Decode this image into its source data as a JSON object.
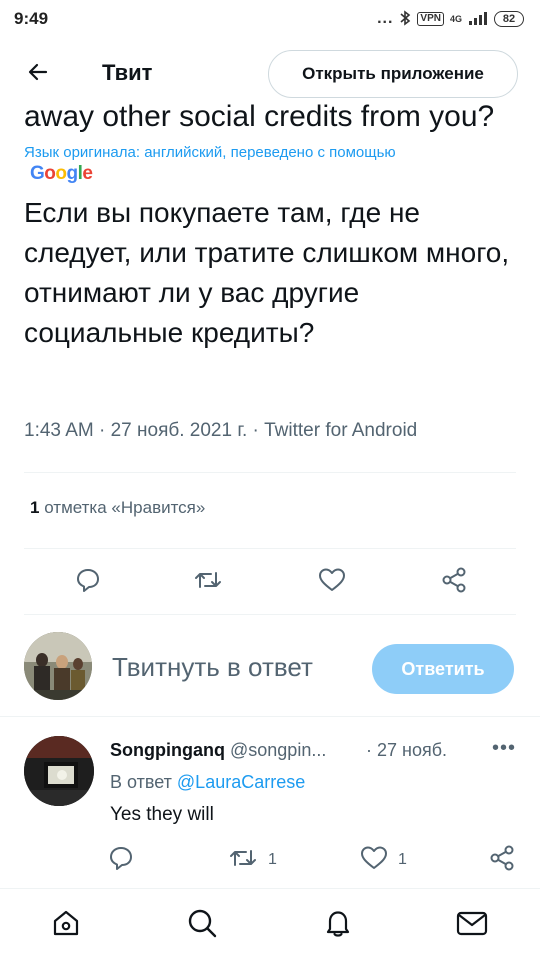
{
  "status_bar": {
    "time": "9:49",
    "dots": "...",
    "vpn": "VPN",
    "network": "4G",
    "battery": "82"
  },
  "header": {
    "title": "Твит",
    "open_app_label": "Открыть приложение"
  },
  "tweet": {
    "original_text": "away other social credits from you?",
    "translation_note": "Язык оригинала: английский, переведено с помощью",
    "translator": "Google",
    "translated_text": "Если вы покупаете там, где не следует, или тратите слишком много, отнимают ли у вас другие социальные кредиты?",
    "meta": "1:43 AM · 27 нояб. 2021 г. · Twitter for Android",
    "likes_count": "1",
    "likes_label": "отметка «Нравится»"
  },
  "compose": {
    "placeholder": "Твитнуть в ответ",
    "reply_button": "Ответить"
  },
  "reply": {
    "name": "Songpinganq",
    "handle": "@songpin...",
    "date": "· 27 нояб.",
    "more": "•••",
    "reply_to_prefix": "В ответ",
    "reply_to_user": "@LauraCarrese",
    "text": "Yes they will",
    "retweets": "1",
    "likes": "1"
  },
  "icons": {
    "back": "arrow-left-icon",
    "comment": "comment-icon",
    "retweet": "retweet-icon",
    "like": "heart-icon",
    "share": "share-icon",
    "home": "home-icon",
    "search": "search-icon",
    "notifications": "bell-icon",
    "messages": "mail-icon"
  },
  "colors": {
    "accent": "#1d9bf0",
    "reply_button_disabled": "#8ecdf8",
    "secondary_text": "#536471"
  }
}
